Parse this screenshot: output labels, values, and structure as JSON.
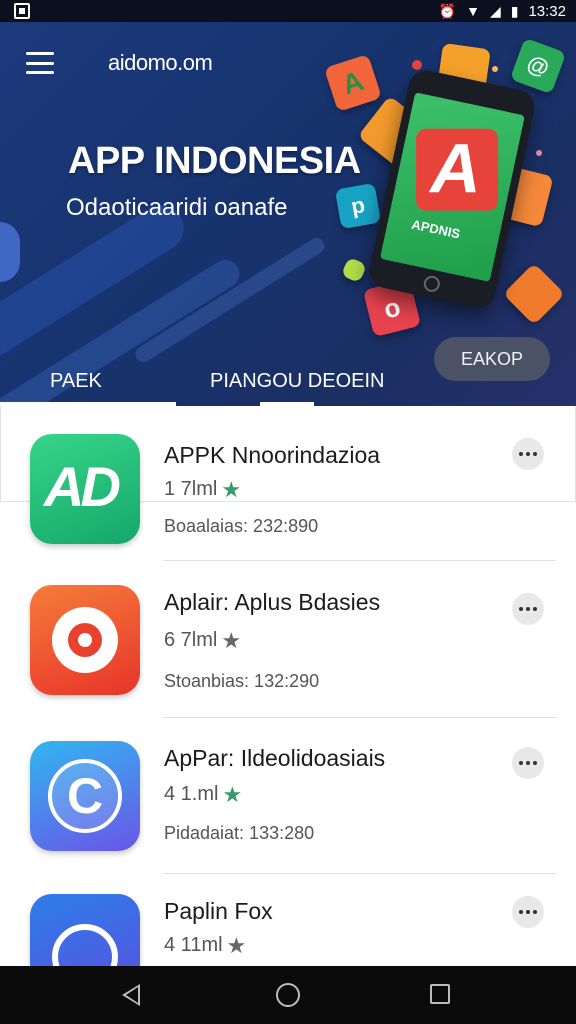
{
  "status_bar": {
    "time": "13:32",
    "icons": [
      "screenshot-icon",
      "alarm-icon",
      "wifi-icon",
      "signal-icon",
      "battery-icon"
    ]
  },
  "header": {
    "site_name": "aidomo.om",
    "title": "APP INDONESIA",
    "subtitle": "Odaoticaaridi oanafe",
    "phone_label": "APDNIS"
  },
  "tabs": [
    {
      "label": "PAEK"
    },
    {
      "label": "PIANGOU DEOEIN"
    },
    {
      "label": "EAKOP"
    }
  ],
  "apps": [
    {
      "name": "APPK Nnoorindazioa",
      "rating": "1 7lml",
      "star_color": "#3a9a6e",
      "downloads": "Boaalaias: 232:890",
      "icon": "app-icon-green-ad"
    },
    {
      "name": "Aplair: Aplus Bdasies",
      "rating": "6 7lml",
      "star_color": "#666666",
      "downloads": "Stoanbias: 132:290",
      "icon": "app-icon-red-ring"
    },
    {
      "name": "ApPar: Ildeolidoasiais",
      "rating": "4 1.ml",
      "star_color": "#3a9a6e",
      "downloads": "Pidadaiat: 133:280",
      "icon": "app-icon-blue-c"
    },
    {
      "name": "Paplin Fox",
      "rating": "4 11ml",
      "star_color": "#666666",
      "downloads": "",
      "icon": "app-icon-blue-fox"
    }
  ],
  "colors": {
    "header_bg": "#1c3a7c",
    "accent_green": "#3a9a6e",
    "nav_bg": "#0b0b0b"
  }
}
